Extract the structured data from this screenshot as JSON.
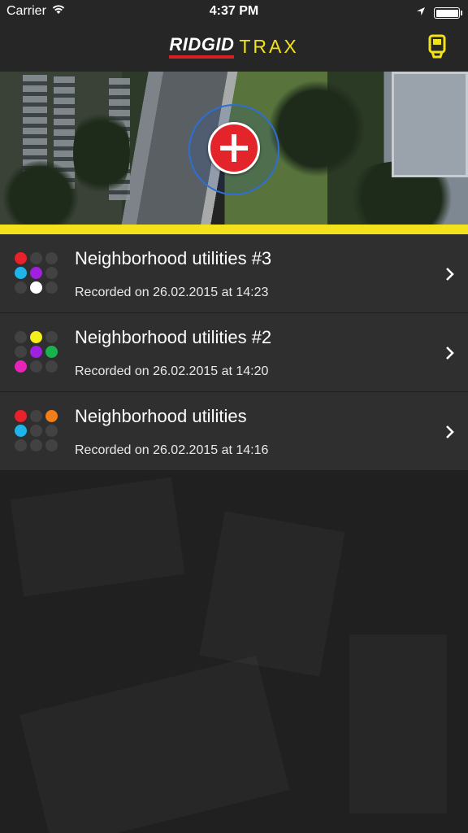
{
  "status_bar": {
    "carrier": "Carrier",
    "time": "4:37 PM",
    "battery_level": 1.0
  },
  "header": {
    "brand_primary": "RIDGID",
    "brand_secondary": "TRAX",
    "brand_accent_color": "#f2e21a",
    "brand_red": "#d81f26",
    "device_icon": "locator-device-icon"
  },
  "map": {
    "add_icon": "plus-icon",
    "add_color": "#e3242b",
    "divider_color": "#f3e21b"
  },
  "recordings": [
    {
      "title": "Neighborhood utilities #3",
      "subtitle": "Recorded on 26.02.2015 at 14:23",
      "dots": [
        "#e8212b",
        "#424242",
        "#424242",
        "#1fb5e8",
        "#a020e0",
        "#424242",
        "#424242",
        "#ffffff",
        "#424242"
      ]
    },
    {
      "title": "Neighborhood utilities #2",
      "subtitle": "Recorded on 26.02.2015 at 14:20",
      "dots": [
        "#424242",
        "#f4ee1a",
        "#424242",
        "#424242",
        "#a020e0",
        "#18b34f",
        "#e724b8",
        "#424242",
        "#424242"
      ]
    },
    {
      "title": "Neighborhood utilities",
      "subtitle": "Recorded on 26.02.2015 at 14:16",
      "dots": [
        "#e8212b",
        "#424242",
        "#f07f1a",
        "#1fb5e8",
        "#424242",
        "#424242",
        "#424242",
        "#424242",
        "#424242"
      ]
    }
  ]
}
